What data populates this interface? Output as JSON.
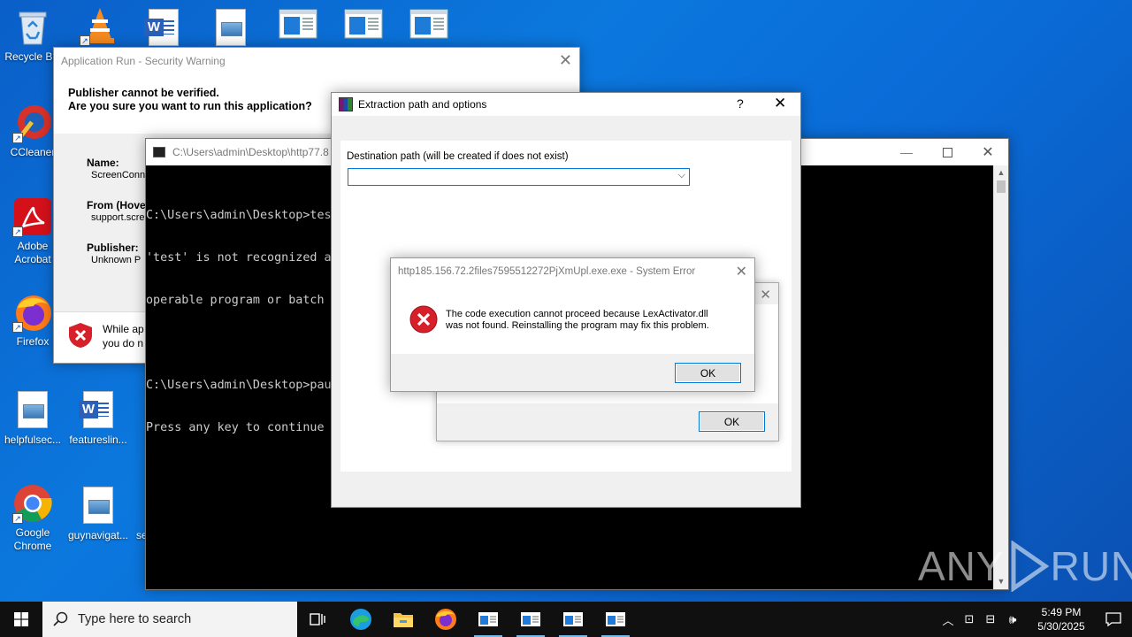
{
  "desktop": {
    "icons": [
      {
        "label": "Recycle Bin"
      },
      {
        "label": "CCleaner"
      },
      {
        "label": "Adobe Acrobat"
      },
      {
        "label": "Firefox"
      },
      {
        "label": "helpfulsec..."
      },
      {
        "label": "featureslin..."
      },
      {
        "label": "Google Chrome"
      },
      {
        "label": "guynavigat..."
      },
      {
        "label": "se"
      }
    ]
  },
  "security_warning": {
    "title": "Application Run - Security Warning",
    "heading1": "Publisher cannot be verified.",
    "heading2": "Are you sure you want to run this application?",
    "name_label": "Name:",
    "name_value": "ScreenConn",
    "from_label": "From (Hove",
    "from_value": "support.scre",
    "publisher_label": "Publisher:",
    "publisher_value": "Unknown P",
    "warning_line1": "While ap",
    "warning_line2": "you do n"
  },
  "console": {
    "title": "C:\\Users\\admin\\Desktop\\http77.8",
    "lines": [
      "C:\\Users\\admin\\Desktop>tes",
      "'test' is not recognized as",
      "operable program or batch f",
      "",
      "C:\\Users\\admin\\Desktop>paus",
      "Press any key to continue"
    ]
  },
  "extraction": {
    "title": "Extraction path and options",
    "help": "?",
    "dest_label": "Destination path (will be created if does not exist)",
    "dest_value": ""
  },
  "back_dialog": {
    "ok": "OK"
  },
  "system_error": {
    "title": "http185.156.72.2files7595512272PjXmUpl.exe.exe - System Error",
    "message_line1": "The code execution cannot proceed because LexActivator.dll",
    "message_line2": "was not found. Reinstalling the program may fix this problem.",
    "ok": "OK"
  },
  "taskbar": {
    "search_placeholder": "Type here to search",
    "time": "5:49 PM",
    "date": "5/30/2025"
  },
  "watermark": {
    "left": "ANY",
    "right": "RUN"
  },
  "colors": {
    "desktop": "#0b78de",
    "taskbar": "#101010",
    "accent": "#0078d7",
    "error_red": "#d6202a"
  }
}
